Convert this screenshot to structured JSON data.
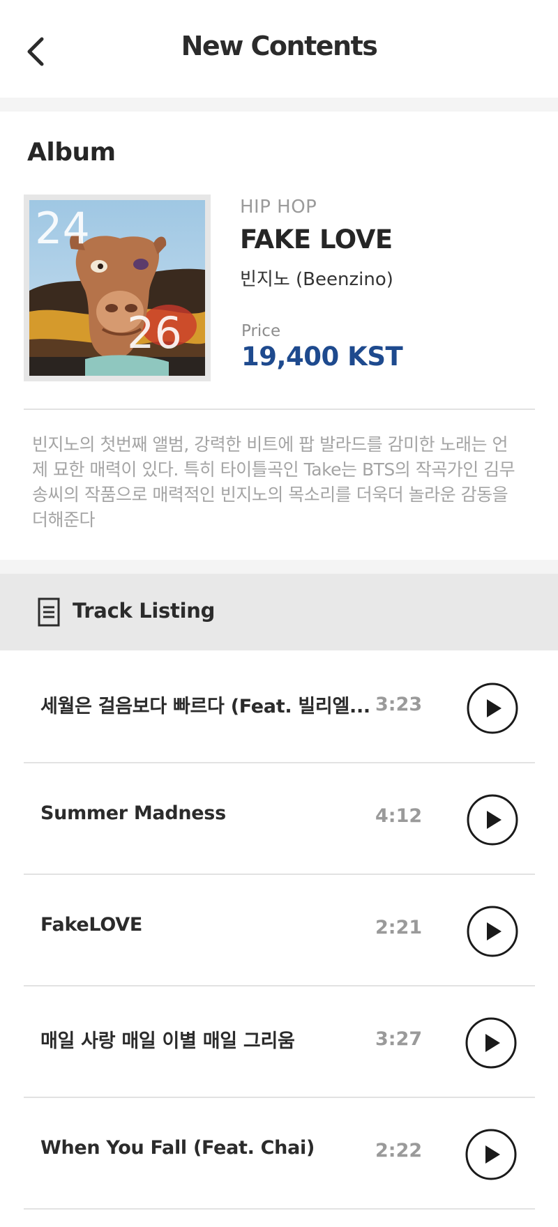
{
  "header": {
    "title": "New Contents"
  },
  "album": {
    "section_title": "Album",
    "cover_numbers": [
      "24",
      "26"
    ],
    "genre": "HIP HOP",
    "title": "FAKE LOVE",
    "artist": "빈지노 (Beenzino)",
    "price_label": "Price",
    "price_value": "19,400 KST",
    "description": "빈지노의 첫번째 앨범, 강력한 비트에 팝 발라드를 감미한 노래는 언제 묘한 매력이 있다. 특히 타이틀곡인 Take는 BTS의 작곡가인 김무송씨의 작품으로 매력적인 빈지노의 목소리를 더욱더 놀라운 감동을 더해준다"
  },
  "tracks": {
    "header_label": "Track Listing",
    "items": [
      {
        "title": "세월은 걸음보다 빠르다 (Feat. 빌리엘...",
        "duration": "3:23"
      },
      {
        "title": "Summer Madness",
        "duration": "4:12"
      },
      {
        "title": "FakeLOVE",
        "duration": "2:21"
      },
      {
        "title": "매일 사랑 매일 이별 매일 그리움",
        "duration": "3:27"
      },
      {
        "title": "When You Fall (Feat. Chai)",
        "duration": "2:22"
      }
    ]
  },
  "colors": {
    "accent": "#1e4a8e",
    "band": "#f4f4f4",
    "track_header_bg": "#e8e8e8"
  },
  "icons": {
    "back": "chevron-left-icon",
    "track_listing": "document-icon",
    "play": "play-circle-icon"
  }
}
